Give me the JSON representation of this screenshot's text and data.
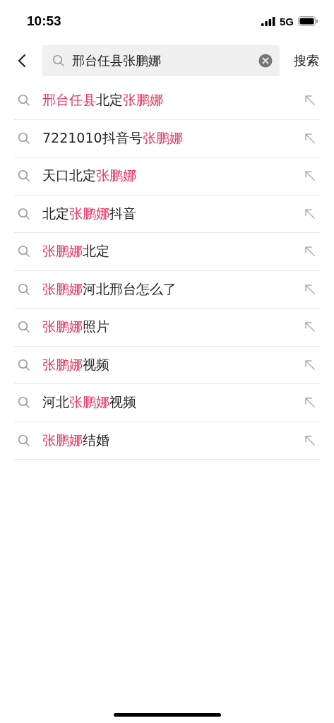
{
  "status_bar": {
    "time": "10:53",
    "network": "5G"
  },
  "search": {
    "value": "邢台任县张鹏娜",
    "action": "搜索"
  },
  "suggestions": [
    {
      "parts": [
        {
          "text": "邢台任县",
          "highlight": true
        },
        {
          "text": "北定",
          "highlight": false
        },
        {
          "text": "张鹏娜",
          "highlight": true
        }
      ]
    },
    {
      "parts": [
        {
          "text": "7221010抖音号",
          "highlight": false
        },
        {
          "text": "张鹏娜",
          "highlight": true
        }
      ]
    },
    {
      "parts": [
        {
          "text": "天口北定",
          "highlight": false
        },
        {
          "text": "张鹏娜",
          "highlight": true
        }
      ]
    },
    {
      "parts": [
        {
          "text": "北定",
          "highlight": false
        },
        {
          "text": "张鹏娜",
          "highlight": true
        },
        {
          "text": "抖音",
          "highlight": false
        }
      ]
    },
    {
      "parts": [
        {
          "text": "张鹏娜",
          "highlight": true
        },
        {
          "text": "北定",
          "highlight": false
        }
      ]
    },
    {
      "parts": [
        {
          "text": "张鹏娜",
          "highlight": true
        },
        {
          "text": "河北邢台怎么了",
          "highlight": false
        }
      ]
    },
    {
      "parts": [
        {
          "text": "张鹏娜",
          "highlight": true
        },
        {
          "text": "照片",
          "highlight": false
        }
      ]
    },
    {
      "parts": [
        {
          "text": "张鹏娜",
          "highlight": true
        },
        {
          "text": "视频",
          "highlight": false
        }
      ]
    },
    {
      "parts": [
        {
          "text": "河北",
          "highlight": false
        },
        {
          "text": "张鹏娜",
          "highlight": true
        },
        {
          "text": "视频",
          "highlight": false
        }
      ]
    },
    {
      "parts": [
        {
          "text": "张鹏娜",
          "highlight": true
        },
        {
          "text": "结婚",
          "highlight": false
        }
      ]
    }
  ]
}
